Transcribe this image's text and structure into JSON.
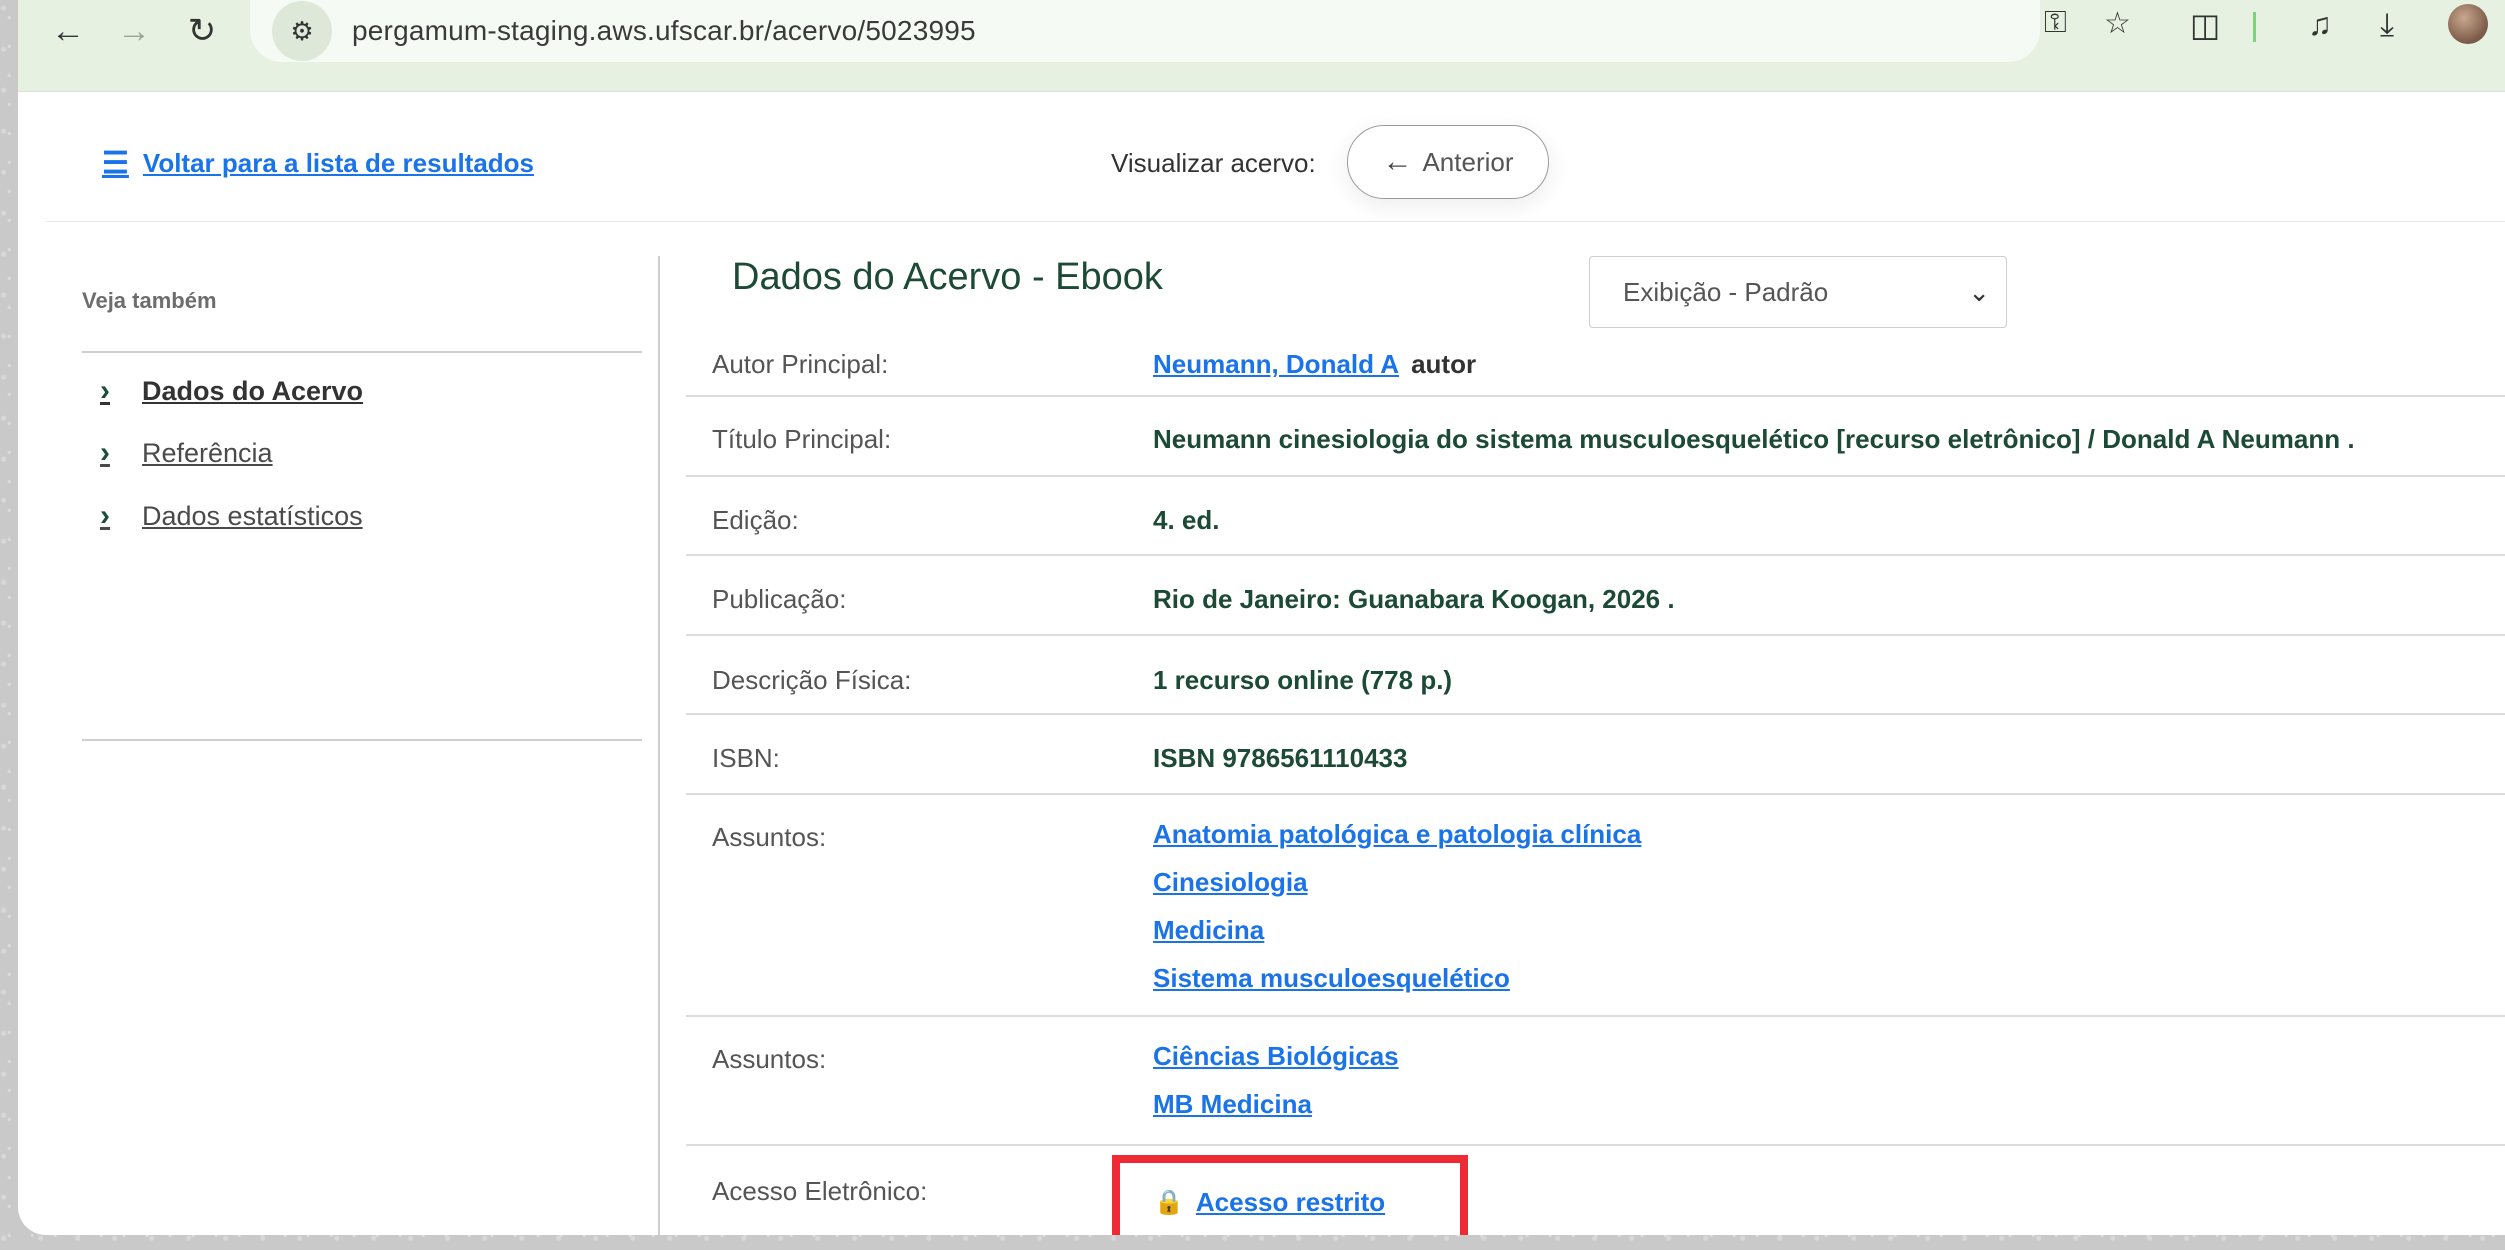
{
  "browser": {
    "url": "pergamum-staging.aws.ufscar.br/acervo/5023995"
  },
  "topbar": {
    "back_link": "Voltar para a lista de resultados",
    "view_label": "Visualizar acervo:",
    "prev_button": "Anterior"
  },
  "sidebar": {
    "title": "Veja também",
    "items": [
      {
        "label": "Dados do Acervo"
      },
      {
        "label": "Referência"
      },
      {
        "label": "Dados estatísticos"
      }
    ]
  },
  "main": {
    "title": "Dados do Acervo - Ebook",
    "display_select": "Exibição - Padrão",
    "fields": {
      "author_label": "Autor Principal:",
      "author_link": "Neumann, Donald A",
      "author_role": "autor",
      "title_label": "Título Principal:",
      "title_value": "Neumann cinesiologia do sistema musculoesquelético  [recurso eletrônico] /  Donald A Neumann .",
      "edition_label": "Edição:",
      "edition_value": "4. ed.",
      "publication_label": "Publicação:",
      "publication_value": "Rio de Janeiro:  Guanabara Koogan,  2026 .",
      "physical_label": "Descrição Física:",
      "physical_value": "1 recurso online (778 p.)",
      "isbn_label": "ISBN:",
      "isbn_value": "ISBN 9786561110433",
      "subjects1_label": "Assuntos:",
      "subjects1": [
        "Anatomia patológica e patologia clínica",
        "Cinesiologia",
        "Medicina",
        "Sistema musculoesquelético"
      ],
      "subjects2_label": "Assuntos:",
      "subjects2": [
        "Ciências Biológicas",
        "MB Medicina"
      ],
      "access_label": "Acesso Eletrônico:",
      "access_link": "Acesso restrito"
    }
  }
}
